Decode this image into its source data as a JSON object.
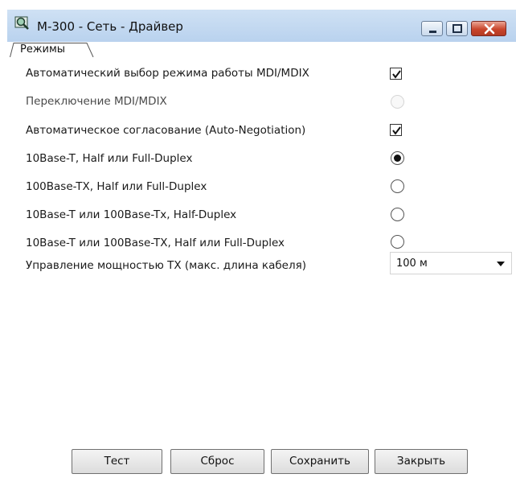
{
  "window": {
    "title": "М-300 - Сеть - Драйвер",
    "icon": "magnifier-app-icon",
    "controls": [
      "minimize-icon",
      "maximize-icon",
      "close-icon"
    ]
  },
  "tabs": [
    {
      "label": "Режимы",
      "active": true
    }
  ],
  "settings": [
    {
      "label": "Автоматический выбор режима работы MDI/MDIX",
      "control": "checkbox",
      "checked": true,
      "enabled": true
    },
    {
      "label": "Переключение MDI/MDIX",
      "control": "radio",
      "checked": false,
      "enabled": false
    },
    {
      "label": "Автоматическое согласование (Auto-Negotiation)",
      "control": "checkbox",
      "checked": true,
      "enabled": true
    },
    {
      "label": "10Base-T, Half или Full-Duplex",
      "control": "radio",
      "checked": true,
      "enabled": true
    },
    {
      "label": "100Base-TX, Half или Full-Duplex",
      "control": "radio",
      "checked": false,
      "enabled": true
    },
    {
      "label": "10Base-T или 100Base-Tx, Half-Duplex",
      "control": "radio",
      "checked": false,
      "enabled": true
    },
    {
      "label": "10Base-T или 100Base-TX, Half или Full-Duplex",
      "control": "radio",
      "checked": false,
      "enabled": true
    },
    {
      "label": "Управление мощностью TX (макс. длина кабеля)",
      "control": "select",
      "value": "100 м",
      "enabled": true
    }
  ],
  "buttons": {
    "test": "Тест",
    "reset": "Сброс",
    "save": "Сохранить",
    "close": "Закрыть"
  },
  "colors": {
    "titlebar": "#c3d8f0",
    "close_button": "#c9462c"
  }
}
